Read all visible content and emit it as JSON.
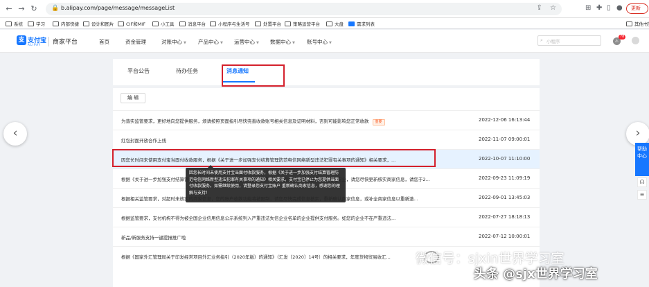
{
  "browser": {
    "url": "b.alipay.com/page/message/messageList",
    "update_label": "更新",
    "bookmarks": [
      "系统",
      "学习",
      "内部快捷",
      "设计和图片",
      "CIF和MIF",
      "小工具",
      "消息平台",
      "小程序与生活号",
      "处置平台",
      "策略运营平台",
      "大盘",
      "需求列表"
    ],
    "other_bookmarks": "其他书签"
  },
  "header": {
    "logo_text": "支付宝",
    "logo_sub": "ALIPAY",
    "platform": "商家平台",
    "nav": [
      "首页",
      "资金管理",
      "对账中心",
      "产品中心",
      "运营中心",
      "数据中心",
      "账号中心"
    ],
    "search_placeholder": "小程序",
    "notification_count": "78"
  },
  "tabs": [
    "平台公告",
    "待办任务",
    "消息通知"
  ],
  "active_tab": "消息通知",
  "edit_label": "编 辑",
  "messages": [
    {
      "text": "为落实监管要求，更好地向您提供服务，烦请按照页面指引尽快完善收款账号相关信息及证明材料，否则可能影响您正常收款",
      "tag": "重要",
      "date": "2022-12-06 16:13:44"
    },
    {
      "text": "红包封面开放合作上线",
      "tag": "",
      "date": "2022-11-07 09:00:01"
    },
    {
      "text": "因您长时间未使用支付宝当面付收款服务，根据《关于进一步加强支付结算管理防范电信网络新型违法犯罪有关事项的通知》相关要求，...",
      "tag": "",
      "date": "2022-10-07 11:10:00"
    },
    {
      "text": "根据《关于进一步加强支付结算管理防范电信网络新型违法犯罪有关事项的通知》相关要求，为保障您的资金安全，请您尽快更新核实商家信息，请您于2...",
      "tag": "",
      "date": "2022-09-23 11:09:19"
    },
    {
      "text": "根据相关监管要求，对超时未核实的商家信息，您的账户收款功能将被限制，请您尽快完成信息核实，重新确认商家信息，或补全商家信息以重新激...",
      "tag": "",
      "date": "2022-09-01 13:45:03"
    },
    {
      "text": "根据监管要求，支付机构不得为被全国企业信用信息公示系统列入严重违法失信企业名单的企业提供支付服务。如您的企业不在严重违法...",
      "tag": "",
      "date": "2022-07-27 18:18:13"
    },
    {
      "text": "新品/新服务支持一键提报推广啦",
      "tag": "",
      "date": "2022-07-12 10:00:01"
    },
    {
      "text": "根据《国家外汇管理局关于印发经常项目外汇业务指引（2020年版）的通知》（汇发〔2020〕14号）的相关要求，年度货物贸易收汇...",
      "tag": "",
      "date": ""
    }
  ],
  "tooltip": "因您长时间未使用支付宝当面付收款服务，根据《关于进一步加强支付结算管理防范电信网络新型违法犯罪有关事项的通知》相关要求，支付宝已停止为您提供当面付收款服务。如需继续使用，请登录您支付宝账户                重新确认商家信息，感谢您的理解与支持！",
  "side_help": "帮助中心",
  "watermarks": {
    "wechat": "微信号：sjxin世界学习室",
    "toutiao": "头条 @sjx世界学习室"
  }
}
